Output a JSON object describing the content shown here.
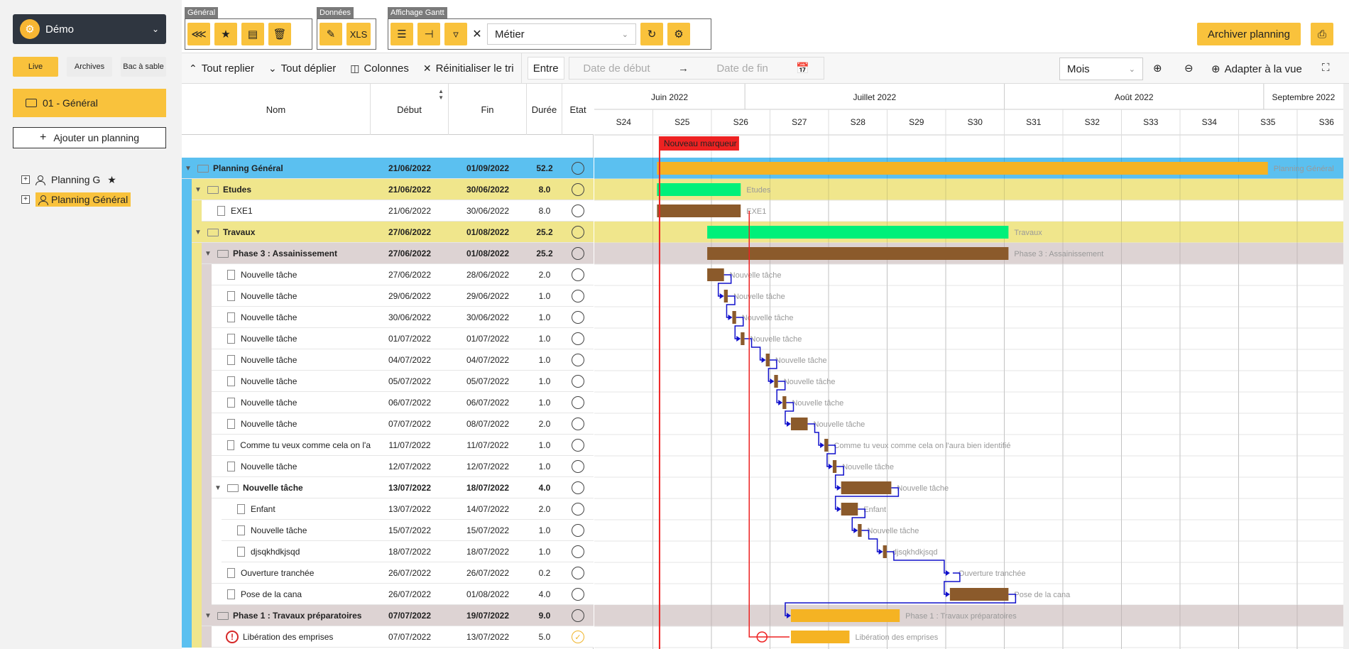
{
  "org": {
    "name": "Démo"
  },
  "modes": {
    "live": "Live",
    "archives": "Archives",
    "sandbox": "Bac à sable"
  },
  "folder": {
    "label": "01 - Général"
  },
  "add_planning": "Ajouter un planning",
  "tree": [
    {
      "label": "Planning G",
      "starred": true,
      "selected": false
    },
    {
      "label": "Planning Général",
      "starred": false,
      "selected": true
    }
  ],
  "toolbar": {
    "group_general": "Général",
    "group_donnees": "Données",
    "group_gantt": "Affichage Gantt",
    "xls_label": "XLS",
    "metier_value": "Métier",
    "archive_label": "Archiver planning"
  },
  "subbar": {
    "collapse": "Tout replier",
    "expand": "Tout déplier",
    "columns": "Colonnes",
    "reset_sort": "Réinitialiser le tri",
    "between": "Entre",
    "start_placeholder": "Date de début",
    "end_placeholder": "Date de fin",
    "scale": "Mois",
    "fit": "Adapter à la vue"
  },
  "columns": {
    "name": "Nom",
    "start": "Début",
    "end": "Fin",
    "duration": "Durée",
    "state": "Etat"
  },
  "timeline": {
    "months": [
      {
        "label": "Juin 2022"
      },
      {
        "label": "Juillet 2022"
      },
      {
        "label": "Août 2022"
      },
      {
        "label": "Septembre 2022"
      }
    ],
    "weeks": [
      "S24",
      "S25",
      "S26",
      "S27",
      "S28",
      "S29",
      "S30",
      "S31",
      "S32",
      "S33",
      "S34",
      "S35",
      "S36"
    ],
    "first_week_start": "2022-06-13",
    "marker": {
      "label": "Nouveau marqueur",
      "date": "2022-06-20"
    }
  },
  "colors": {
    "accent": "#f9c23c",
    "level0": "#5bc0f0",
    "level1": "#f0e68c",
    "level2": "#ddd3d3",
    "bar_task": "#8b5a2b",
    "bar_green": "#00f07a",
    "bar_orange": "#f5b323",
    "marker": "#ee2222",
    "link": "#1010cc"
  },
  "rows": [
    {
      "level": 0,
      "type": "group",
      "name": "Planning Général",
      "start": "21/06/2022",
      "end": "01/09/2022",
      "duration": "52.2",
      "state": "open",
      "bar_color": "orange",
      "bar_label": "Planning Général"
    },
    {
      "level": 1,
      "type": "group",
      "name": "Etudes",
      "start": "21/06/2022",
      "end": "30/06/2022",
      "duration": "8.0",
      "state": "open",
      "bar_color": "green",
      "bar_label": "Etudes"
    },
    {
      "level": 2,
      "type": "task",
      "name": "EXE1",
      "start": "21/06/2022",
      "end": "30/06/2022",
      "duration": "8.0",
      "state": "open",
      "bar_color": "task",
      "bar_label": "EXE1"
    },
    {
      "level": 1,
      "type": "group",
      "name": "Travaux",
      "start": "27/06/2022",
      "end": "01/08/2022",
      "duration": "25.2",
      "state": "open",
      "bar_color": "green",
      "bar_label": "Travaux"
    },
    {
      "level": 2,
      "type": "group",
      "name": "Phase 3 : Assainissement",
      "start": "27/06/2022",
      "end": "01/08/2022",
      "duration": "25.2",
      "state": "open",
      "bar_color": "task",
      "bar_label": "Phase 3 : Assainissement"
    },
    {
      "level": 3,
      "type": "task",
      "name": "Nouvelle tâche",
      "start": "27/06/2022",
      "end": "28/06/2022",
      "duration": "2.0",
      "state": "open",
      "bar_color": "task",
      "bar_label": "Nouvelle tâche"
    },
    {
      "level": 3,
      "type": "task",
      "name": "Nouvelle tâche",
      "start": "29/06/2022",
      "end": "29/06/2022",
      "duration": "1.0",
      "state": "open",
      "bar_color": "task",
      "bar_label": "Nouvelle tâche"
    },
    {
      "level": 3,
      "type": "task",
      "name": "Nouvelle tâche",
      "start": "30/06/2022",
      "end": "30/06/2022",
      "duration": "1.0",
      "state": "open",
      "bar_color": "task",
      "bar_label": "Nouvelle tâche"
    },
    {
      "level": 3,
      "type": "task",
      "name": "Nouvelle tâche",
      "start": "01/07/2022",
      "end": "01/07/2022",
      "duration": "1.0",
      "state": "open",
      "bar_color": "task",
      "bar_label": "Nouvelle tâche"
    },
    {
      "level": 3,
      "type": "task",
      "name": "Nouvelle tâche",
      "start": "04/07/2022",
      "end": "04/07/2022",
      "duration": "1.0",
      "state": "open",
      "bar_color": "task",
      "bar_label": "Nouvelle tâche"
    },
    {
      "level": 3,
      "type": "task",
      "name": "Nouvelle tâche",
      "start": "05/07/2022",
      "end": "05/07/2022",
      "duration": "1.0",
      "state": "open",
      "bar_color": "task",
      "bar_label": "Nouvelle tâche"
    },
    {
      "level": 3,
      "type": "task",
      "name": "Nouvelle tâche",
      "start": "06/07/2022",
      "end": "06/07/2022",
      "duration": "1.0",
      "state": "open",
      "bar_color": "task",
      "bar_label": "Nouvelle tâche"
    },
    {
      "level": 3,
      "type": "task",
      "name": "Nouvelle tâche",
      "start": "07/07/2022",
      "end": "08/07/2022",
      "duration": "2.0",
      "state": "open",
      "bar_color": "task",
      "bar_label": "Nouvelle tâche"
    },
    {
      "level": 3,
      "type": "task",
      "name": "Comme tu veux comme cela on l'a",
      "start": "11/07/2022",
      "end": "11/07/2022",
      "duration": "1.0",
      "state": "open",
      "bar_color": "task",
      "bar_label": "Comme tu veux comme cela on l'aura bien identifié"
    },
    {
      "level": 3,
      "type": "task",
      "name": "Nouvelle tâche",
      "start": "12/07/2022",
      "end": "12/07/2022",
      "duration": "1.0",
      "state": "open",
      "bar_color": "task",
      "bar_label": "Nouvelle tâche"
    },
    {
      "level": 3,
      "type": "group",
      "name": "Nouvelle tâche",
      "start": "13/07/2022",
      "end": "18/07/2022",
      "duration": "4.0",
      "state": "open",
      "bar_color": "task",
      "bar_label": "Nouvelle tâche"
    },
    {
      "level": 4,
      "type": "task",
      "name": "Enfant",
      "start": "13/07/2022",
      "end": "14/07/2022",
      "duration": "2.0",
      "state": "open",
      "bar_color": "task",
      "bar_label": "Enfant"
    },
    {
      "level": 4,
      "type": "task",
      "name": "Nouvelle tâche",
      "start": "15/07/2022",
      "end": "15/07/2022",
      "duration": "1.0",
      "state": "open",
      "bar_color": "task",
      "bar_label": "Nouvelle tâche"
    },
    {
      "level": 4,
      "type": "task",
      "name": "djsqkhdkjsqd",
      "start": "18/07/2022",
      "end": "18/07/2022",
      "duration": "1.0",
      "state": "open",
      "bar_color": "task",
      "bar_label": "djsqkhdkjsqd"
    },
    {
      "level": 3,
      "type": "task",
      "name": "Ouverture tranchée",
      "start": "26/07/2022",
      "end": "26/07/2022",
      "duration": "0.2",
      "state": "open",
      "bar_color": "none",
      "bar_label": "Ouverture tranchée"
    },
    {
      "level": 3,
      "type": "task",
      "name": "Pose de la cana",
      "start": "26/07/2022",
      "end": "01/08/2022",
      "duration": "4.0",
      "state": "open",
      "bar_color": "task",
      "bar_label": "Pose de la cana"
    },
    {
      "level": 2,
      "type": "group",
      "name": "Phase 1 : Travaux préparatoires",
      "start": "07/07/2022",
      "end": "19/07/2022",
      "duration": "9.0",
      "state": "open",
      "bar_color": "orange",
      "bar_label": "Phase 1 : Travaux préparatoires"
    },
    {
      "level": 3,
      "type": "task",
      "name": "Libération des emprises",
      "start": "07/07/2022",
      "end": "13/07/2022",
      "duration": "5.0",
      "state": "done",
      "warning": true,
      "bar_color": "orange",
      "bar_label": "Libération des emprises"
    }
  ]
}
